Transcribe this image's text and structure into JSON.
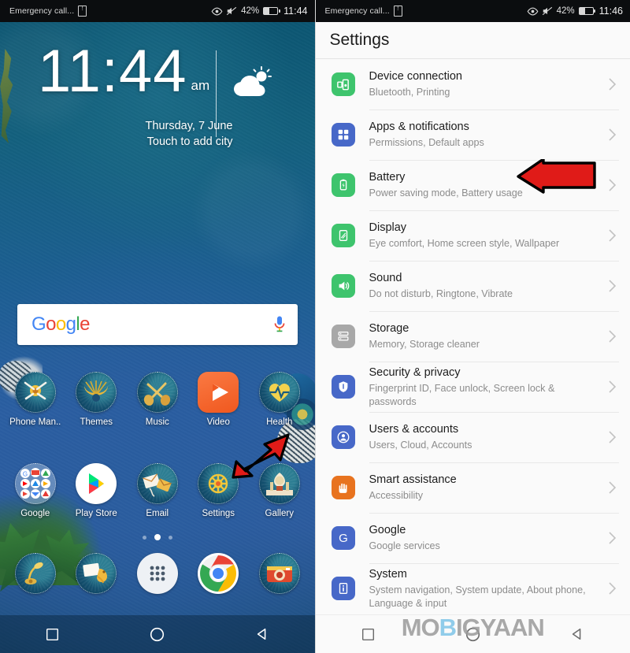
{
  "home": {
    "statusbar": {
      "carrier": "Emergency call...",
      "sim_icon": "sim-card-alert-icon",
      "eye_icon": "eye-comfort-icon",
      "mute_icon": "volume-mute-icon",
      "battery_percent": "42%",
      "battery_icon": "battery-icon",
      "battery_level": 42,
      "clock": "11:44"
    },
    "clock_widget": {
      "time": "11:44",
      "ampm": "am",
      "date": "Thursday, 7 June",
      "city_hint": "Touch to add city",
      "weather_icon": "partly-cloudy-icon"
    },
    "search": {
      "logo": "Google",
      "logo_letters": [
        "G",
        "o",
        "o",
        "g",
        "l",
        "e"
      ],
      "mic_icon": "microphone-icon",
      "placeholder": ""
    },
    "apps_row1": [
      {
        "label": "Phone Man..",
        "icon": "phone-manager-icon"
      },
      {
        "label": "Themes",
        "icon": "themes-icon"
      },
      {
        "label": "Music",
        "icon": "music-icon"
      },
      {
        "label": "Video",
        "icon": "video-icon"
      },
      {
        "label": "Health",
        "icon": "health-icon"
      }
    ],
    "apps_row2": [
      {
        "label": "Google",
        "icon": "google-folder-icon"
      },
      {
        "label": "Play Store",
        "icon": "play-store-icon"
      },
      {
        "label": "Email",
        "icon": "email-icon"
      },
      {
        "label": "Settings",
        "icon": "settings-icon"
      },
      {
        "label": "Gallery",
        "icon": "gallery-icon"
      }
    ],
    "page_dots": {
      "count": 3,
      "active": 1
    },
    "dock": [
      {
        "label": "Phone",
        "icon": "dialer-icon"
      },
      {
        "label": "Messages",
        "icon": "messages-icon"
      },
      {
        "label": "App drawer",
        "icon": "app-drawer-icon"
      },
      {
        "label": "Chrome",
        "icon": "chrome-icon"
      },
      {
        "label": "Camera",
        "icon": "camera-icon"
      }
    ],
    "navbar": [
      {
        "icon": "recents-icon"
      },
      {
        "icon": "home-icon"
      },
      {
        "icon": "back-icon"
      }
    ],
    "arrow": {
      "icon": "red-arrow-down-left",
      "color": "#e01b18",
      "points_to": "Settings"
    }
  },
  "settings": {
    "statusbar": {
      "carrier": "Emergency call...",
      "sim_icon": "sim-card-alert-icon",
      "eye_icon": "eye-comfort-icon",
      "mute_icon": "volume-mute-icon",
      "battery_percent": "42%",
      "battery_icon": "battery-icon",
      "battery_level": 42,
      "clock": "11:46"
    },
    "title": "Settings",
    "items": [
      {
        "title": "Device connection",
        "subtitle": "Bluetooth, Printing",
        "icon": "device-connection-icon",
        "color": "#3ec46d"
      },
      {
        "title": "Apps & notifications",
        "subtitle": "Permissions, Default apps",
        "icon": "apps-notifications-icon",
        "color": "#4768c8"
      },
      {
        "title": "Battery",
        "subtitle": "Power saving mode, Battery usage",
        "icon": "battery-settings-icon",
        "color": "#3ec46d"
      },
      {
        "title": "Display",
        "subtitle": "Eye comfort, Home screen style, Wallpaper",
        "icon": "display-icon",
        "color": "#3ec46d"
      },
      {
        "title": "Sound",
        "subtitle": "Do not disturb, Ringtone, Vibrate",
        "icon": "sound-icon",
        "color": "#3ec46d"
      },
      {
        "title": "Storage",
        "subtitle": "Memory, Storage cleaner",
        "icon": "storage-icon",
        "color": "#a8a8a8"
      },
      {
        "title": "Security & privacy",
        "subtitle": "Fingerprint ID, Face unlock, Screen lock & passwords",
        "icon": "security-privacy-icon",
        "color": "#4768c8"
      },
      {
        "title": "Users & accounts",
        "subtitle": "Users, Cloud, Accounts",
        "icon": "users-accounts-icon",
        "color": "#4768c8"
      },
      {
        "title": "Smart assistance",
        "subtitle": "Accessibility",
        "icon": "smart-assistance-icon",
        "color": "#e8731f"
      },
      {
        "title": "Google",
        "subtitle": "Google services",
        "icon": "google-icon",
        "color": "#4768c8"
      },
      {
        "title": "System",
        "subtitle": "System navigation, System update, About phone, Language & input",
        "icon": "system-icon",
        "color": "#4768c8"
      }
    ],
    "chevron_icon": "chevron-right-icon",
    "navbar": [
      {
        "icon": "recents-icon"
      },
      {
        "icon": "home-icon"
      },
      {
        "icon": "back-icon"
      }
    ],
    "arrow": {
      "icon": "red-arrow-left",
      "color": "#e01b18",
      "points_to": "Battery"
    },
    "watermark": "MOBIGYAAN"
  }
}
